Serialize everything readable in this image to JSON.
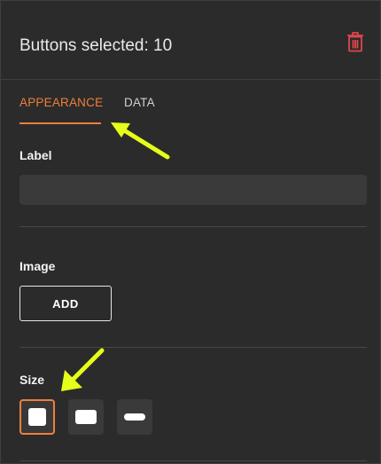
{
  "header": {
    "title": "Buttons selected: 10",
    "delete_icon": "trash-icon",
    "delete_color": "#e0474c"
  },
  "tabs": [
    {
      "label": "APPEARANCE",
      "active": true
    },
    {
      "label": "DATA",
      "active": false
    }
  ],
  "accent_color": "#f07f3a",
  "label_section": {
    "title": "Label",
    "value": ""
  },
  "image_section": {
    "title": "Image",
    "add_label": "ADD"
  },
  "size_section": {
    "title": "Size",
    "options": [
      {
        "shape": "square",
        "selected": true
      },
      {
        "shape": "wide-rounded",
        "selected": false
      },
      {
        "shape": "pill",
        "selected": false
      }
    ]
  },
  "annotation_color": "#e6ff1a"
}
